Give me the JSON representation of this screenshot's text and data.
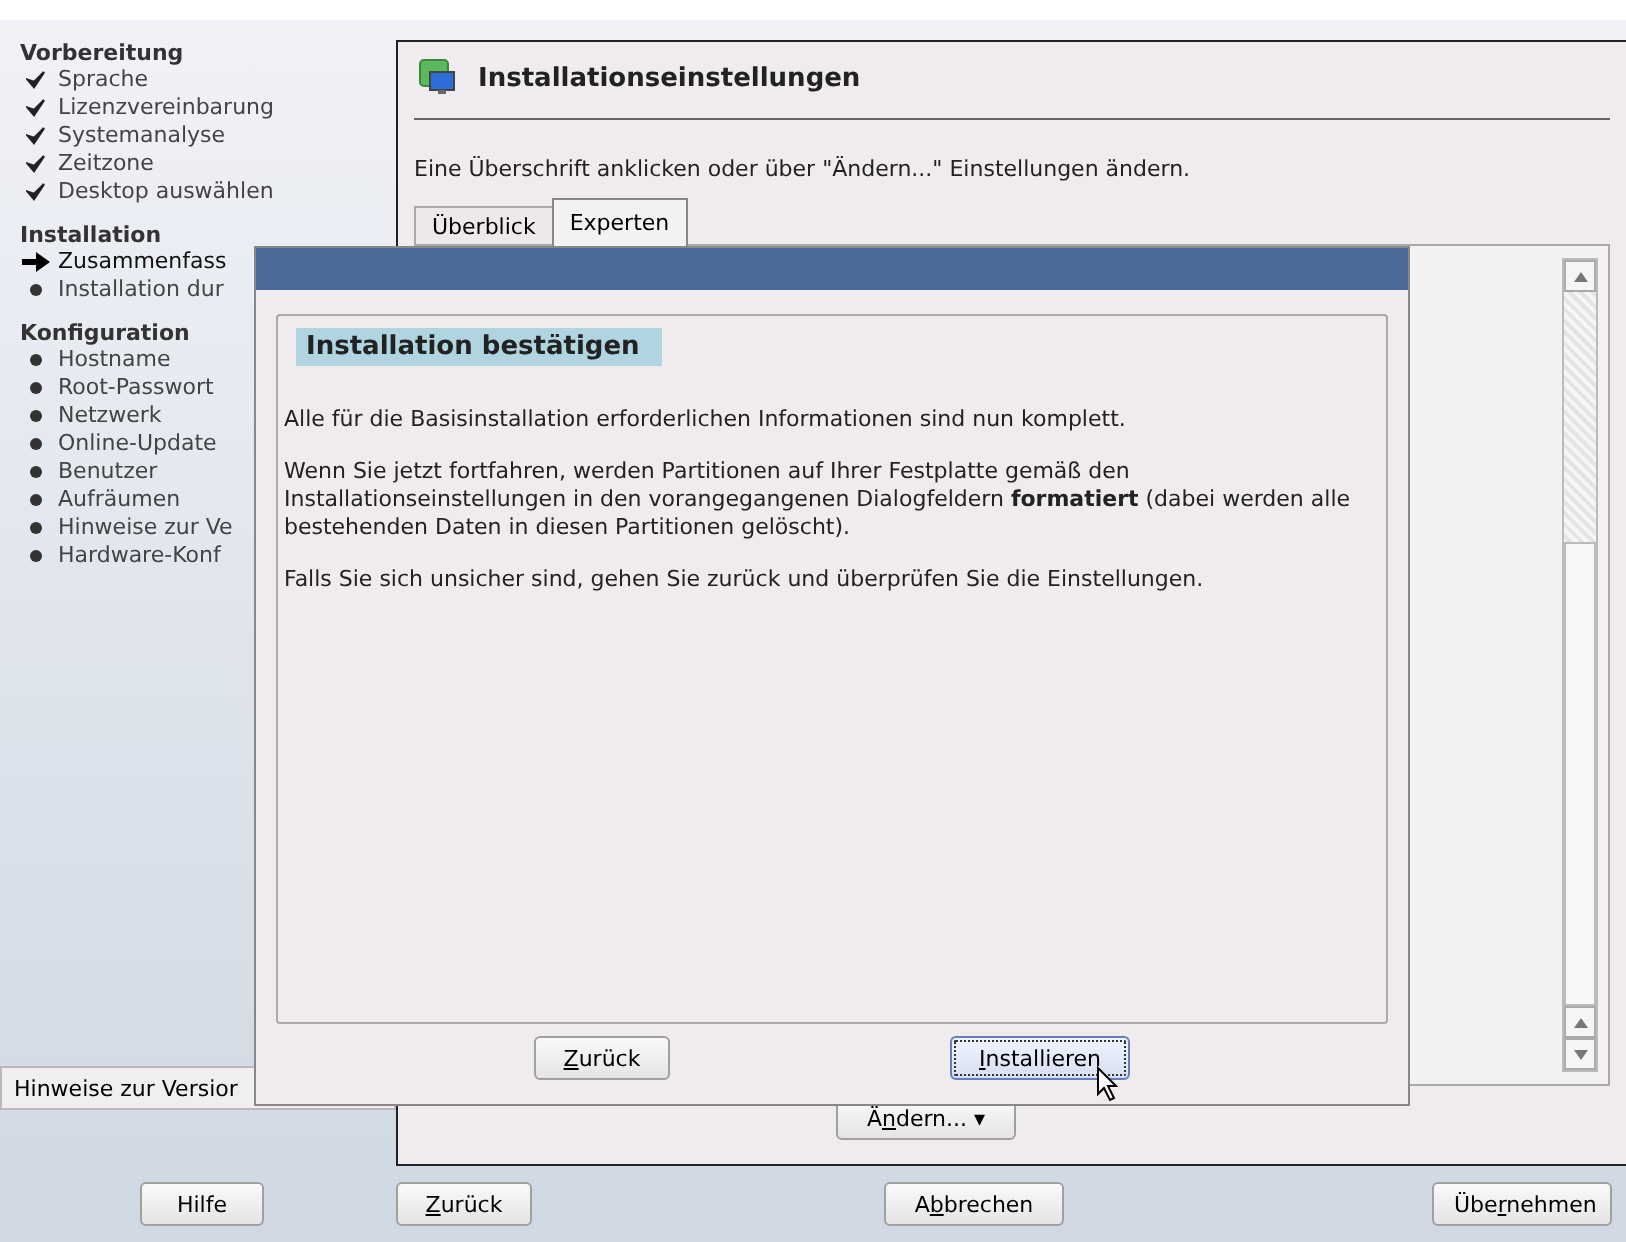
{
  "sidebar": {
    "sections": [
      {
        "title": "Vorbereitung",
        "items": [
          {
            "label": "Sprache",
            "kind": "done"
          },
          {
            "label": "Lizenzvereinbarung",
            "kind": "done"
          },
          {
            "label": "Systemanalyse",
            "kind": "done"
          },
          {
            "label": "Zeitzone",
            "kind": "done"
          },
          {
            "label": "Desktop auswählen",
            "kind": "done"
          }
        ]
      },
      {
        "title": "Installation",
        "items": [
          {
            "label": "Zusammenfass",
            "kind": "current"
          },
          {
            "label": "Installation dur",
            "kind": "pending"
          }
        ]
      },
      {
        "title": "Konfiguration",
        "items": [
          {
            "label": "Hostname",
            "kind": "pending"
          },
          {
            "label": "Root-Passwort",
            "kind": "pending"
          },
          {
            "label": "Netzwerk",
            "kind": "pending"
          },
          {
            "label": "Online-Update",
            "kind": "pending"
          },
          {
            "label": "Benutzer",
            "kind": "pending"
          },
          {
            "label": "Aufräumen",
            "kind": "pending"
          },
          {
            "label": "Hinweise zur Ve",
            "kind": "pending"
          },
          {
            "label": "Hardware-Konf",
            "kind": "pending"
          }
        ]
      }
    ],
    "release_notes_button": "Hinweise zur Versior"
  },
  "main": {
    "title": "Installationseinstellungen",
    "hint": "Eine Überschrift anklicken oder über \"Ändern...\" Einstellungen ändern.",
    "tabs": [
      {
        "label": "Überblick",
        "selected": false
      },
      {
        "label": "Experten",
        "selected": true
      }
    ],
    "change_button": {
      "pre": "Ä",
      "key": "n",
      "post": "dern...",
      "caret": "▾"
    }
  },
  "dialog": {
    "heading": "Installation bestätigen",
    "paragraphs": [
      "Alle für die Basisinstallation erforderlichen Informationen sind nun komplett.",
      "Wenn Sie jetzt fortfahren, werden Partitionen auf Ihrer Festplatte gemäß den Installationseinstellungen in den vorangegangenen Dialogfeldern **formatiert** (dabei werden alle bestehenden Daten in diesen Partitionen gelöscht).",
      "Falls Sie sich unsicher sind, gehen Sie zurück und überprüfen Sie die Einstellungen."
    ],
    "buttons": [
      {
        "key": "Z",
        "post": "urück",
        "focused": false
      },
      {
        "key": "I",
        "post": "nstallieren",
        "focused": true
      }
    ]
  },
  "footer": {
    "buttons": [
      {
        "pre": "Hilfe"
      },
      {
        "key": "Z",
        "post": "urück"
      },
      {
        "pre": "A",
        "key": "b",
        "post": "brechen"
      },
      {
        "pre": "Übe",
        "key": "r",
        "post": "nehmen"
      }
    ]
  }
}
